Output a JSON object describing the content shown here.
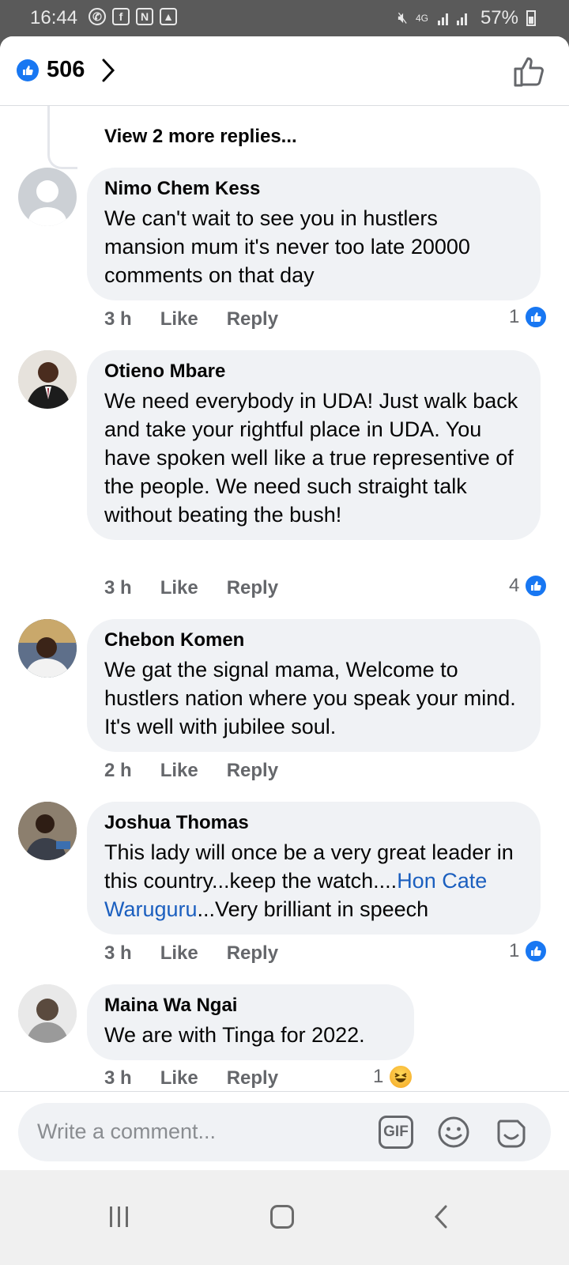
{
  "status_bar": {
    "time": "16:44",
    "battery": "57%",
    "network": "4G"
  },
  "header": {
    "reaction_count": "506"
  },
  "thread": {
    "view_more": "View 2 more replies..."
  },
  "comments": [
    {
      "author": "Nimo Chem Kess",
      "text": "We can't wait to see you in hustlers mansion mum it's never too late  20000 comments on that day",
      "time": "3 h",
      "like_label": "Like",
      "reply_label": "Reply",
      "reaction_count": "1",
      "reaction": "like"
    },
    {
      "author": "Otieno Mbare",
      "text": "We need everybody in UDA! Just walk back and take your rightful place in UDA. You have spoken well like a true representive of the people. We need such straight talk without beating the bush!",
      "time": "3 h",
      "like_label": "Like",
      "reply_label": "Reply",
      "reaction_count": "4",
      "reaction": "like"
    },
    {
      "author": "Chebon Komen",
      "text": "We gat the signal mama, Welcome to hustlers nation where you speak your mind. It's well with jubilee soul.",
      "time": "2 h",
      "like_label": "Like",
      "reply_label": "Reply"
    },
    {
      "author": "Joshua Thomas",
      "text_before": "This lady will once be a very great leader in this country...keep the watch....",
      "mention": "Hon Cate Waruguru",
      "text_after": "...Very brilliant in speech",
      "time": "3 h",
      "like_label": "Like",
      "reply_label": "Reply",
      "reaction_count": "1",
      "reaction": "like"
    },
    {
      "author": "Maina Wa Ngai",
      "text": "We are with Tinga for 2022.",
      "time": "3 h",
      "like_label": "Like",
      "reply_label": "Reply",
      "reaction_count": "1",
      "reaction": "haha"
    }
  ],
  "composer": {
    "placeholder": "Write a comment...",
    "gif_label": "GIF"
  },
  "colors": {
    "accent": "#1877f2",
    "mention": "#1b5fbf",
    "bubble": "#f0f2f5",
    "secondary_text": "#65676b"
  }
}
